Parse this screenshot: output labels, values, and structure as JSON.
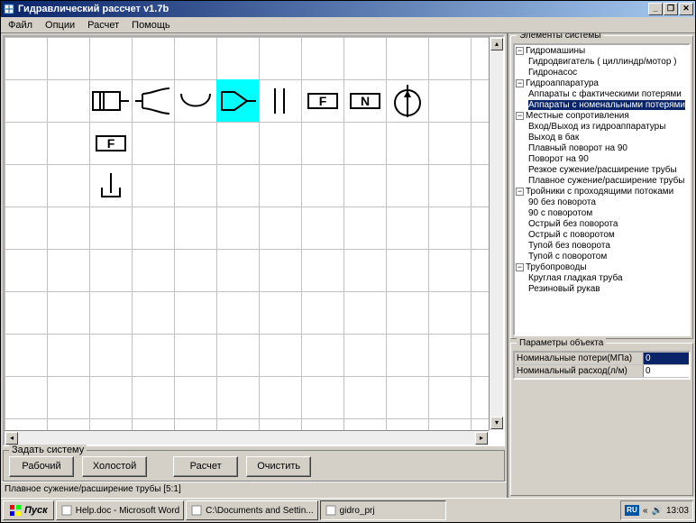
{
  "title": "Гидравлический рассчет v1.7b",
  "menu": {
    "file": "Файл",
    "options": "Опции",
    "calc": "Расчет",
    "help": "Помощь"
  },
  "set_system": {
    "legend": "Задать систему",
    "operating": "Рабочий",
    "idle": "Холостой",
    "calculate": "Расчет",
    "clear": "Очистить"
  },
  "status": "Плавное сужение/расширение трубы [5:1]",
  "elements": {
    "legend": "Элементы системы",
    "tree": [
      {
        "label": "Гидромашины",
        "children": [
          {
            "label": "Гидродвигатель ( циллиндр/мотор )"
          },
          {
            "label": "Гидронасос"
          }
        ]
      },
      {
        "label": "Гидроаппаратура",
        "children": [
          {
            "label": "Аппараты с фактическими потерями"
          },
          {
            "label": "Аппараты с номенальными потерями",
            "selected": true
          }
        ]
      },
      {
        "label": "Местные сопротивления",
        "children": [
          {
            "label": "Вход/Выход из гидроаппаратуры"
          },
          {
            "label": "Выход в бак"
          },
          {
            "label": "Плавный поворот на 90"
          },
          {
            "label": "Поворот на 90"
          },
          {
            "label": "Резкое сужение/расширение трубы"
          },
          {
            "label": "Плавное сужение/расширение трубы"
          }
        ]
      },
      {
        "label": "Тройники с проходящими потоками",
        "children": [
          {
            "label": "90 без поворота"
          },
          {
            "label": "90 с поворотом"
          },
          {
            "label": "Острый без поворота"
          },
          {
            "label": "Острый с поворотом"
          },
          {
            "label": "Тупой без поворота"
          },
          {
            "label": "Тупой с поворотом"
          }
        ]
      },
      {
        "label": "Трубопроводы",
        "children": [
          {
            "label": "Круглая гладкая труба"
          },
          {
            "label": "Резиновый рукав"
          }
        ]
      }
    ]
  },
  "params": {
    "legend": "Параметры объекта",
    "rows": [
      {
        "name": "Номинальные потери(МПа)",
        "value": "0",
        "selected": true
      },
      {
        "name": "Номинальный расход(л/м)",
        "value": "0"
      }
    ]
  },
  "taskbar": {
    "start": "Пуск",
    "items": [
      {
        "label": "Help.doc - Microsoft Word"
      },
      {
        "label": "C:\\Documents and Settin..."
      },
      {
        "label": "gidro_prj",
        "pressed": true
      }
    ],
    "lang": "RU",
    "time": "13:03"
  }
}
